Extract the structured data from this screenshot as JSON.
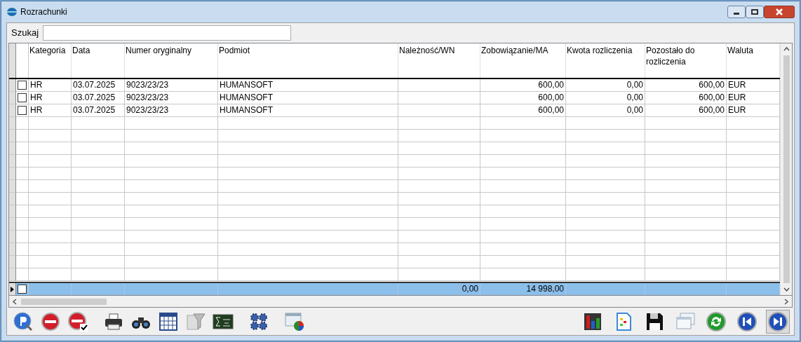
{
  "window": {
    "title": "Rozrachunki"
  },
  "search": {
    "label": "Szukaj"
  },
  "table": {
    "columns": [
      {
        "label": "Kategoria"
      },
      {
        "label": "Data"
      },
      {
        "label": "Numer oryginalny"
      },
      {
        "label": "Podmiot"
      },
      {
        "label": "Należność/WN"
      },
      {
        "label": "Zobowiązanie/MA"
      },
      {
        "label": "Kwota rozliczenia"
      },
      {
        "label": "Pozostało do rozliczenia"
      },
      {
        "label": "Waluta"
      }
    ],
    "rows": [
      {
        "checked": false,
        "cells": [
          "HR",
          "03.07.2025",
          "9023/23/23",
          "HUMANSOFT",
          "",
          "600,00",
          "0,00",
          "600,00",
          "EUR"
        ]
      },
      {
        "checked": false,
        "cells": [
          "HR",
          "03.07.2025",
          "9023/23/23",
          "HUMANSOFT",
          "",
          "600,00",
          "0,00",
          "600,00",
          "EUR"
        ]
      },
      {
        "checked": false,
        "cells": [
          "HR",
          "03.07.2025",
          "9023/23/23",
          "HUMANSOFT",
          "",
          "600,00",
          "0,00",
          "600,00",
          "EUR"
        ]
      }
    ],
    "footer": {
      "checked": false,
      "cells": [
        "",
        "",
        "",
        "",
        "0,00",
        "14 998,00",
        "",
        "",
        ""
      ]
    }
  },
  "toolbar": {
    "left": [
      {
        "kind": "preview",
        "pressed": false
      },
      {
        "kind": "stop",
        "pressed": false
      },
      {
        "kind": "stop-check",
        "pressed": false
      },
      {
        "kind": "printer",
        "pressed": false
      },
      {
        "kind": "binoculars",
        "pressed": false
      },
      {
        "kind": "grid",
        "pressed": false
      },
      {
        "kind": "funnel",
        "pressed": false
      },
      {
        "kind": "sigma",
        "pressed": false
      },
      {
        "kind": "gears",
        "pressed": false
      },
      {
        "kind": "window-chart",
        "pressed": false
      }
    ],
    "right": [
      {
        "kind": "bar-chart",
        "pressed": false
      },
      {
        "kind": "sheet",
        "pressed": false
      },
      {
        "kind": "floppy",
        "pressed": false
      },
      {
        "kind": "windows",
        "pressed": false
      },
      {
        "kind": "refresh",
        "pressed": false
      },
      {
        "kind": "first",
        "pressed": false
      },
      {
        "kind": "last",
        "pressed": true
      }
    ]
  }
}
